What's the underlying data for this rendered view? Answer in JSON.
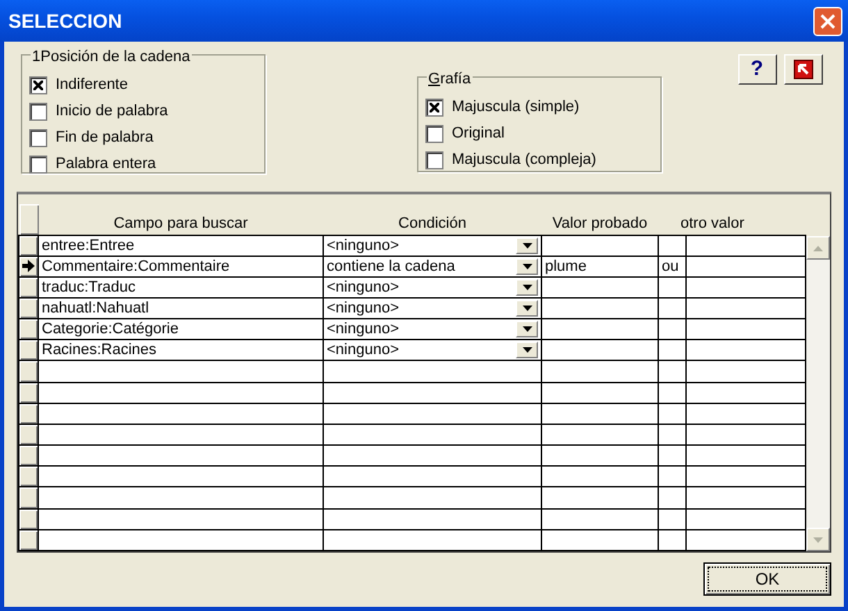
{
  "window": {
    "title": "SELECCION"
  },
  "position_group": {
    "title": "1Posición de la cadena",
    "options": [
      {
        "label": "Indiferente",
        "checked": true
      },
      {
        "label": "Inicio de palabra",
        "checked": false
      },
      {
        "label": "Fin de palabra",
        "checked": false
      },
      {
        "label": "Palabra entera",
        "checked": false
      }
    ]
  },
  "grafia_group": {
    "title": "Grafía",
    "options": [
      {
        "label": "Majuscula (simple)",
        "checked": true
      },
      {
        "label": "Original",
        "checked": false
      },
      {
        "label": "Majuscula (compleja)",
        "checked": false
      }
    ]
  },
  "help_button": {
    "label": "?"
  },
  "table": {
    "columns": [
      "Campo para buscar",
      "Condición",
      "Valor probado",
      "otro valor"
    ],
    "rows": [
      {
        "selected": false,
        "field": "entree:Entree",
        "condition": "<ninguno>",
        "value": "",
        "column_4": "",
        "other": ""
      },
      {
        "selected": true,
        "field": "Commentaire:Commentaire",
        "condition": "contiene la cadena",
        "value": "plume",
        "column_4": "ou",
        "other": ""
      },
      {
        "selected": false,
        "field": "traduc:Traduc",
        "condition": "<ninguno>",
        "value": "",
        "column_4": "",
        "other": ""
      },
      {
        "selected": false,
        "field": "nahuatl:Nahuatl",
        "condition": "<ninguno>",
        "value": "",
        "column_4": "",
        "other": ""
      },
      {
        "selected": false,
        "field": "Categorie:Catégorie",
        "condition": "<ninguno>",
        "value": "",
        "column_4": "",
        "other": ""
      },
      {
        "selected": false,
        "field": "Racines:Racines",
        "condition": "<ninguno>",
        "value": "",
        "column_4": "",
        "other": ""
      }
    ]
  },
  "ok_button": {
    "label": "OK"
  }
}
